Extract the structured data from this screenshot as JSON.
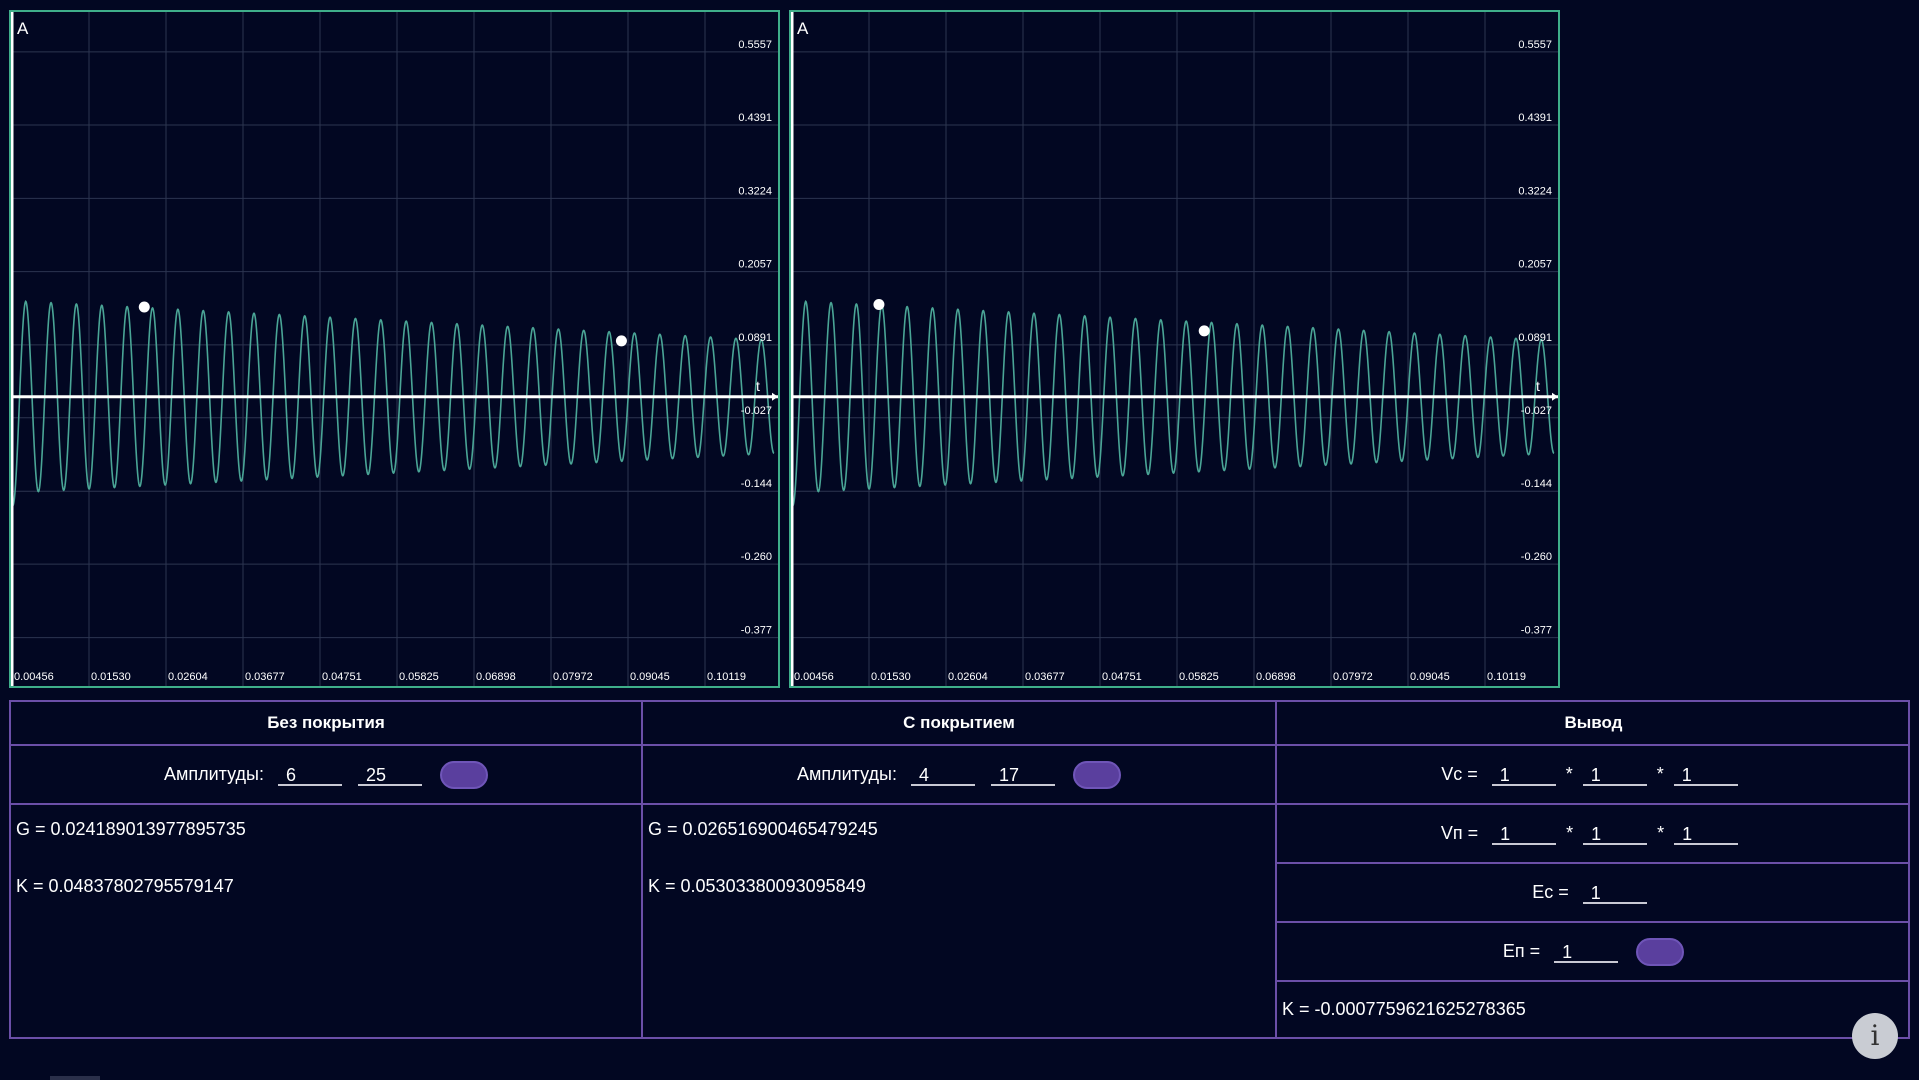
{
  "charts": [
    {
      "y_axis_label": "A",
      "x_axis_label": "t",
      "y_ticks": [
        "0.5557",
        "0.4391",
        "0.3224",
        "0.2057",
        "0.0891",
        "-0.027",
        "-0.144",
        "-0.260",
        "-0.377"
      ],
      "x_ticks": [
        "0.00456",
        "0.01530",
        "0.02604",
        "0.03677",
        "0.04751",
        "0.05825",
        "0.06898",
        "0.07972",
        "0.09045",
        "0.10119"
      ],
      "selected_peaks": [
        6,
        25
      ]
    },
    {
      "y_axis_label": "A",
      "x_axis_label": "t",
      "y_ticks": [
        "0.5557",
        "0.4391",
        "0.3224",
        "0.2057",
        "0.0891",
        "-0.027",
        "-0.144",
        "-0.260",
        "-0.377"
      ],
      "x_ticks": [
        "0.00456",
        "0.01530",
        "0.02604",
        "0.03677",
        "0.04751",
        "0.05825",
        "0.06898",
        "0.07972",
        "0.09045",
        "0.10119"
      ],
      "selected_peaks": [
        4,
        17
      ]
    }
  ],
  "chart_data": [
    {
      "type": "line",
      "title": "",
      "xlabel": "t",
      "ylabel": "A",
      "xlim": [
        0.00456,
        0.1103
      ],
      "ylim": [
        -0.435,
        0.6
      ],
      "signal": {
        "cycles": 30,
        "amp_start": 0.153,
        "amp_end": 0.09,
        "offset": 0.0
      },
      "markers": [
        {
          "x": 0.0228,
          "y": 0.143
        },
        {
          "x": 0.0891,
          "y": 0.089
        }
      ],
      "color": "#4aa596"
    },
    {
      "type": "line",
      "title": "",
      "xlabel": "t",
      "ylabel": "A",
      "xlim": [
        0.00456,
        0.1103
      ],
      "ylim": [
        -0.435,
        0.6
      ],
      "signal": {
        "cycles": 30,
        "amp_start": 0.153,
        "amp_end": 0.09,
        "offset": 0.0
      },
      "markers": [
        {
          "x": 0.0165,
          "y": 0.147
        },
        {
          "x": 0.0617,
          "y": 0.105
        }
      ],
      "color": "#4aa596"
    }
  ],
  "panel_without": {
    "title": "Без покрытия",
    "amplitudes_label": "Амплитуды:",
    "amp1": "6",
    "amp2": "25",
    "g_text": "G = 0.024189013977895735",
    "k_text": "K = 0.04837802795579147"
  },
  "panel_with": {
    "title": "С покрытием",
    "amplitudes_label": "Амплитуды:",
    "amp1": "4",
    "amp2": "17",
    "g_text": "G = 0.026516900465479245",
    "k_text": "K = 0.05303380093095849"
  },
  "panel_output": {
    "title": "Вывод",
    "vc_label": "Vc =",
    "vc_values": [
      "1",
      "1",
      "1"
    ],
    "vp_label": "Vп =",
    "vp_values": [
      "1",
      "1",
      "1"
    ],
    "ec_label": "Ec =",
    "ec_value": "1",
    "ep_label": "Eп =",
    "ep_value": "1",
    "multiply": "*",
    "k_text": "K = -0.0007759621625278365"
  },
  "info_icon": "i",
  "colors": {
    "background": "#020722",
    "chart_border": "#3fae8a",
    "signal": "#4aa596",
    "table_border": "#6b4fa8",
    "toggle": "#5a3f9e"
  }
}
